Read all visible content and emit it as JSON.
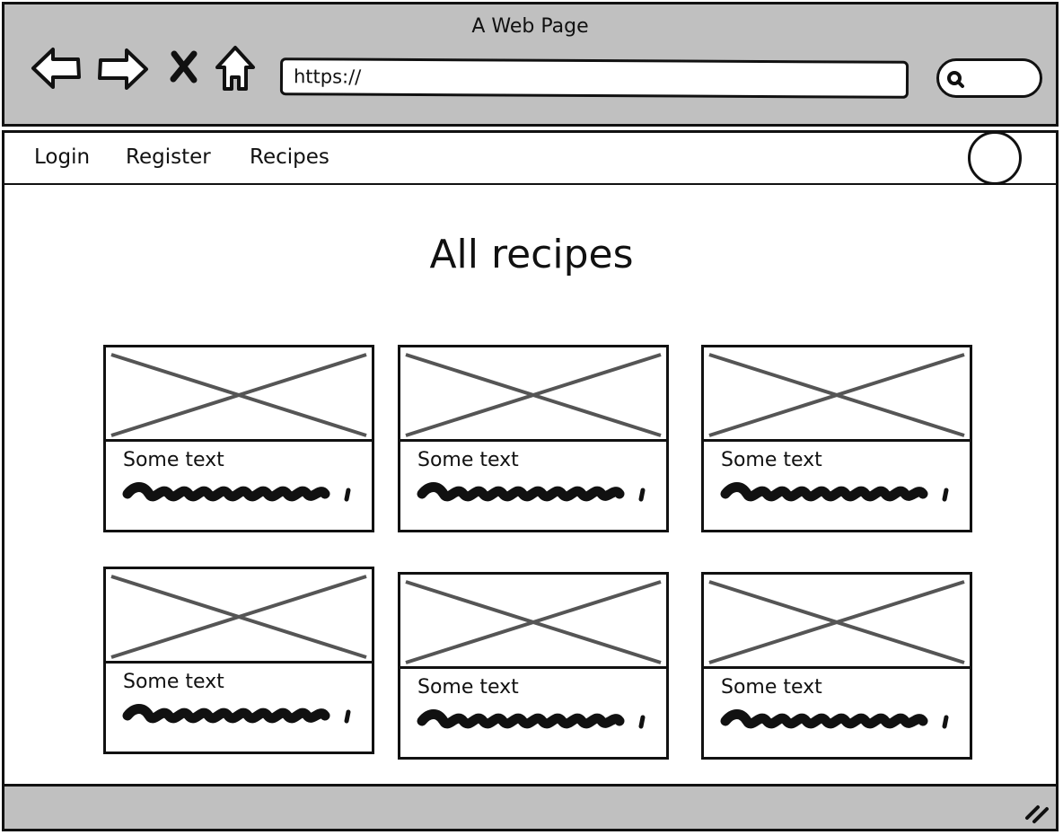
{
  "window": {
    "title": "A Web Page"
  },
  "toolbar": {
    "back_icon": "back-arrow-icon",
    "forward_icon": "forward-arrow-icon",
    "close_icon": "close-x-icon",
    "home_icon": "home-icon",
    "url_value": "https://",
    "search_icon": "search-icon"
  },
  "navbar": {
    "links": [
      "Login",
      "Register",
      "Recipes"
    ],
    "avatar_icon": "user-avatar-circle"
  },
  "main": {
    "title": "All recipes",
    "cards": [
      {
        "text": "Some text"
      },
      {
        "text": "Some text"
      },
      {
        "text": "Some text"
      },
      {
        "text": "Some text"
      },
      {
        "text": "Some text"
      },
      {
        "text": "Some text"
      }
    ]
  },
  "colors": {
    "chrome_gray": "#c0c0c0",
    "stroke": "#111111",
    "placeholder_cross": "#555555"
  }
}
